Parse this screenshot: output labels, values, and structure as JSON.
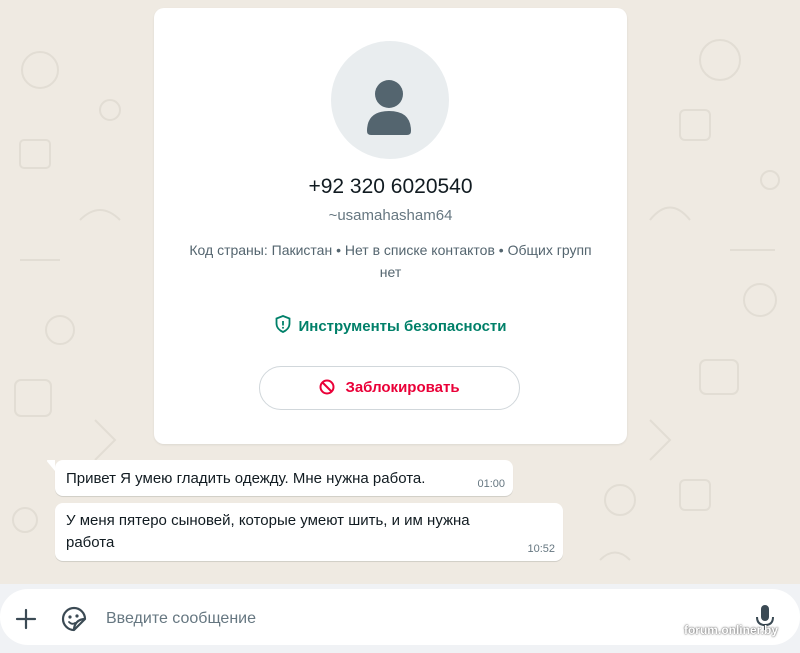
{
  "contact": {
    "phone": "+92 320 6020540",
    "username": "~usamahasham64",
    "info": "Код страны: Пакистан • Нет в списке контактов • Общих групп нет",
    "safety_tools_label": "Инструменты безопасности",
    "block_label": "Заблокировать"
  },
  "messages": [
    {
      "text": "Привет Я умею гладить одежду. Мне нужна работа.",
      "time": "01:00"
    },
    {
      "text": "У меня пятеро сыновей, которые умеют шить, и им нужна работа",
      "time": "10:52"
    }
  ],
  "composer": {
    "placeholder": "Введите сообщение"
  },
  "watermark": "forum.onliner.by",
  "colors": {
    "background": "#efeae2",
    "accent": "#008069",
    "danger": "#ea0038"
  },
  "icons": [
    "person-icon",
    "shield-icon",
    "ban-icon",
    "plus-icon",
    "sticker-icon",
    "microphone-icon"
  ]
}
